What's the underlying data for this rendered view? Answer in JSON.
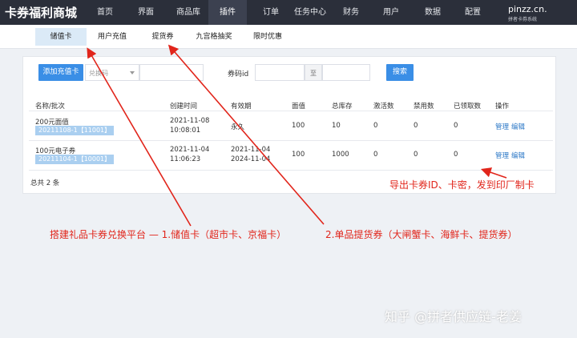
{
  "app": {
    "brand": "卡券福利商城"
  },
  "nav": [
    "首页",
    "界面",
    "商品库",
    "插件",
    "订单",
    "任务中心",
    "财务",
    "用户",
    "数据",
    "配置"
  ],
  "logo": {
    "main": "pinzz.cn.",
    "sub": "拼者卡券系统"
  },
  "subtabs": [
    "储值卡",
    "用户充值",
    "提货券",
    "九宫格抽奖",
    "限时优惠"
  ],
  "toolbar": {
    "add_label": "添加充值卡",
    "select_placeholder": "兑换码",
    "code_id_label": "券码id",
    "to_label": "至",
    "search_label": "搜索"
  },
  "table": {
    "headers": [
      "名称/批次",
      "创建时间",
      "有效期",
      "面值",
      "总库存",
      "激活数",
      "禁用数",
      "已领取数",
      "操作"
    ],
    "rows": [
      {
        "name": "200元面值",
        "batch": "20211108-1【11001】",
        "created_date": "2021-11-08",
        "created_time": "10:08:01",
        "validity_1": "永久",
        "validity_2": "",
        "face": "100",
        "stock": "10",
        "active": "0",
        "disabled": "0",
        "claimed": "0",
        "manage": "管理",
        "edit": "编辑"
      },
      {
        "name": "100元电子券",
        "batch": "20211104-1【10001】",
        "created_date": "2021-11-04",
        "created_time": "11:06:23",
        "validity_1": "2021-11-04",
        "validity_2": "2024-11-04",
        "face": "100",
        "stock": "1000",
        "active": "0",
        "disabled": "0",
        "claimed": "0",
        "manage": "管理",
        "edit": "编辑"
      }
    ],
    "total": "总共 2 条"
  },
  "annotations": {
    "export": "导出卡券ID、卡密，发到印厂制卡",
    "platform": "搭建礼品卡券兑换平台 — 1.储值卡（超市卡、京福卡）",
    "pickup": "2.单品提货券（大闸蟹卡、海鲜卡、提货券）"
  },
  "watermark": "知乎 @拼者供应链-老姜",
  "colors": {
    "topbar": "#2b2f3a",
    "primary": "#3a8ee6",
    "annotation": "#e1251b",
    "tag": "#aacff0",
    "link": "#2d79c7"
  }
}
